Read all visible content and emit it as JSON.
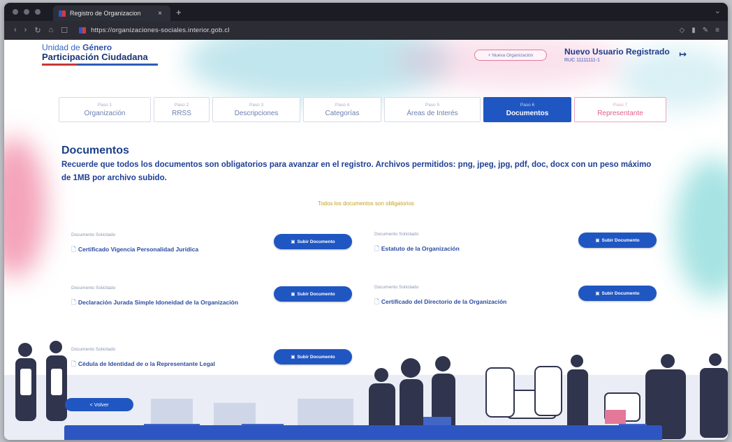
{
  "browser": {
    "tab_title": "Registro de Organizacion",
    "tab_close": "×",
    "new_tab": "+",
    "url": "https://organizaciones-sociales.interior.gob.cl"
  },
  "header": {
    "brand_top_prefix": "Unidad de",
    "brand_top_bold": "Género",
    "brand_main": "Participación Ciudadana",
    "new_org_button": "+ Nueva Organización",
    "user_name": "Nuevo Usuario Registrado",
    "user_id": "RUC 11111111-1",
    "logout_icon": "logout-icon"
  },
  "steps": [
    {
      "num": "Paso 1",
      "label": "Organización"
    },
    {
      "num": "Paso 2",
      "label": "RRSS"
    },
    {
      "num": "Paso 3",
      "label": "Descripciones"
    },
    {
      "num": "Paso 4",
      "label": "Categorías"
    },
    {
      "num": "Paso 5",
      "label": "Áreas de Interés"
    },
    {
      "num": "Paso 6",
      "label": "Documentos"
    },
    {
      "num": "Paso 7",
      "label": "Representante"
    }
  ],
  "active_step": 6,
  "content": {
    "title": "Documentos",
    "description": "Recuerde que todos los documentos son obligatorios para avanzar en el registro. Archivos permitidos: png, jpeg, jpg, pdf, doc, docx con un peso máximo de 1MB por archivo subido.",
    "notice": "Todos los documentos son obligatorios",
    "doc_label": "Documento Solicitado",
    "upload_label": "Subir Documento",
    "documents": [
      "Certificado Vigencia Personalidad Jurídica",
      "Estatuto de la Organización",
      "Declaración Jurada Simple Idoneidad de la Organización",
      "Certificado del Directorio de la Organización",
      "Cédula de Identidad de o la Representante Legal"
    ]
  },
  "back_button": "< Volver",
  "colors": {
    "primary": "#1f56c2",
    "title": "#1c3f8a",
    "notice": "#c8a017",
    "accent_pink": "#e0608a"
  }
}
